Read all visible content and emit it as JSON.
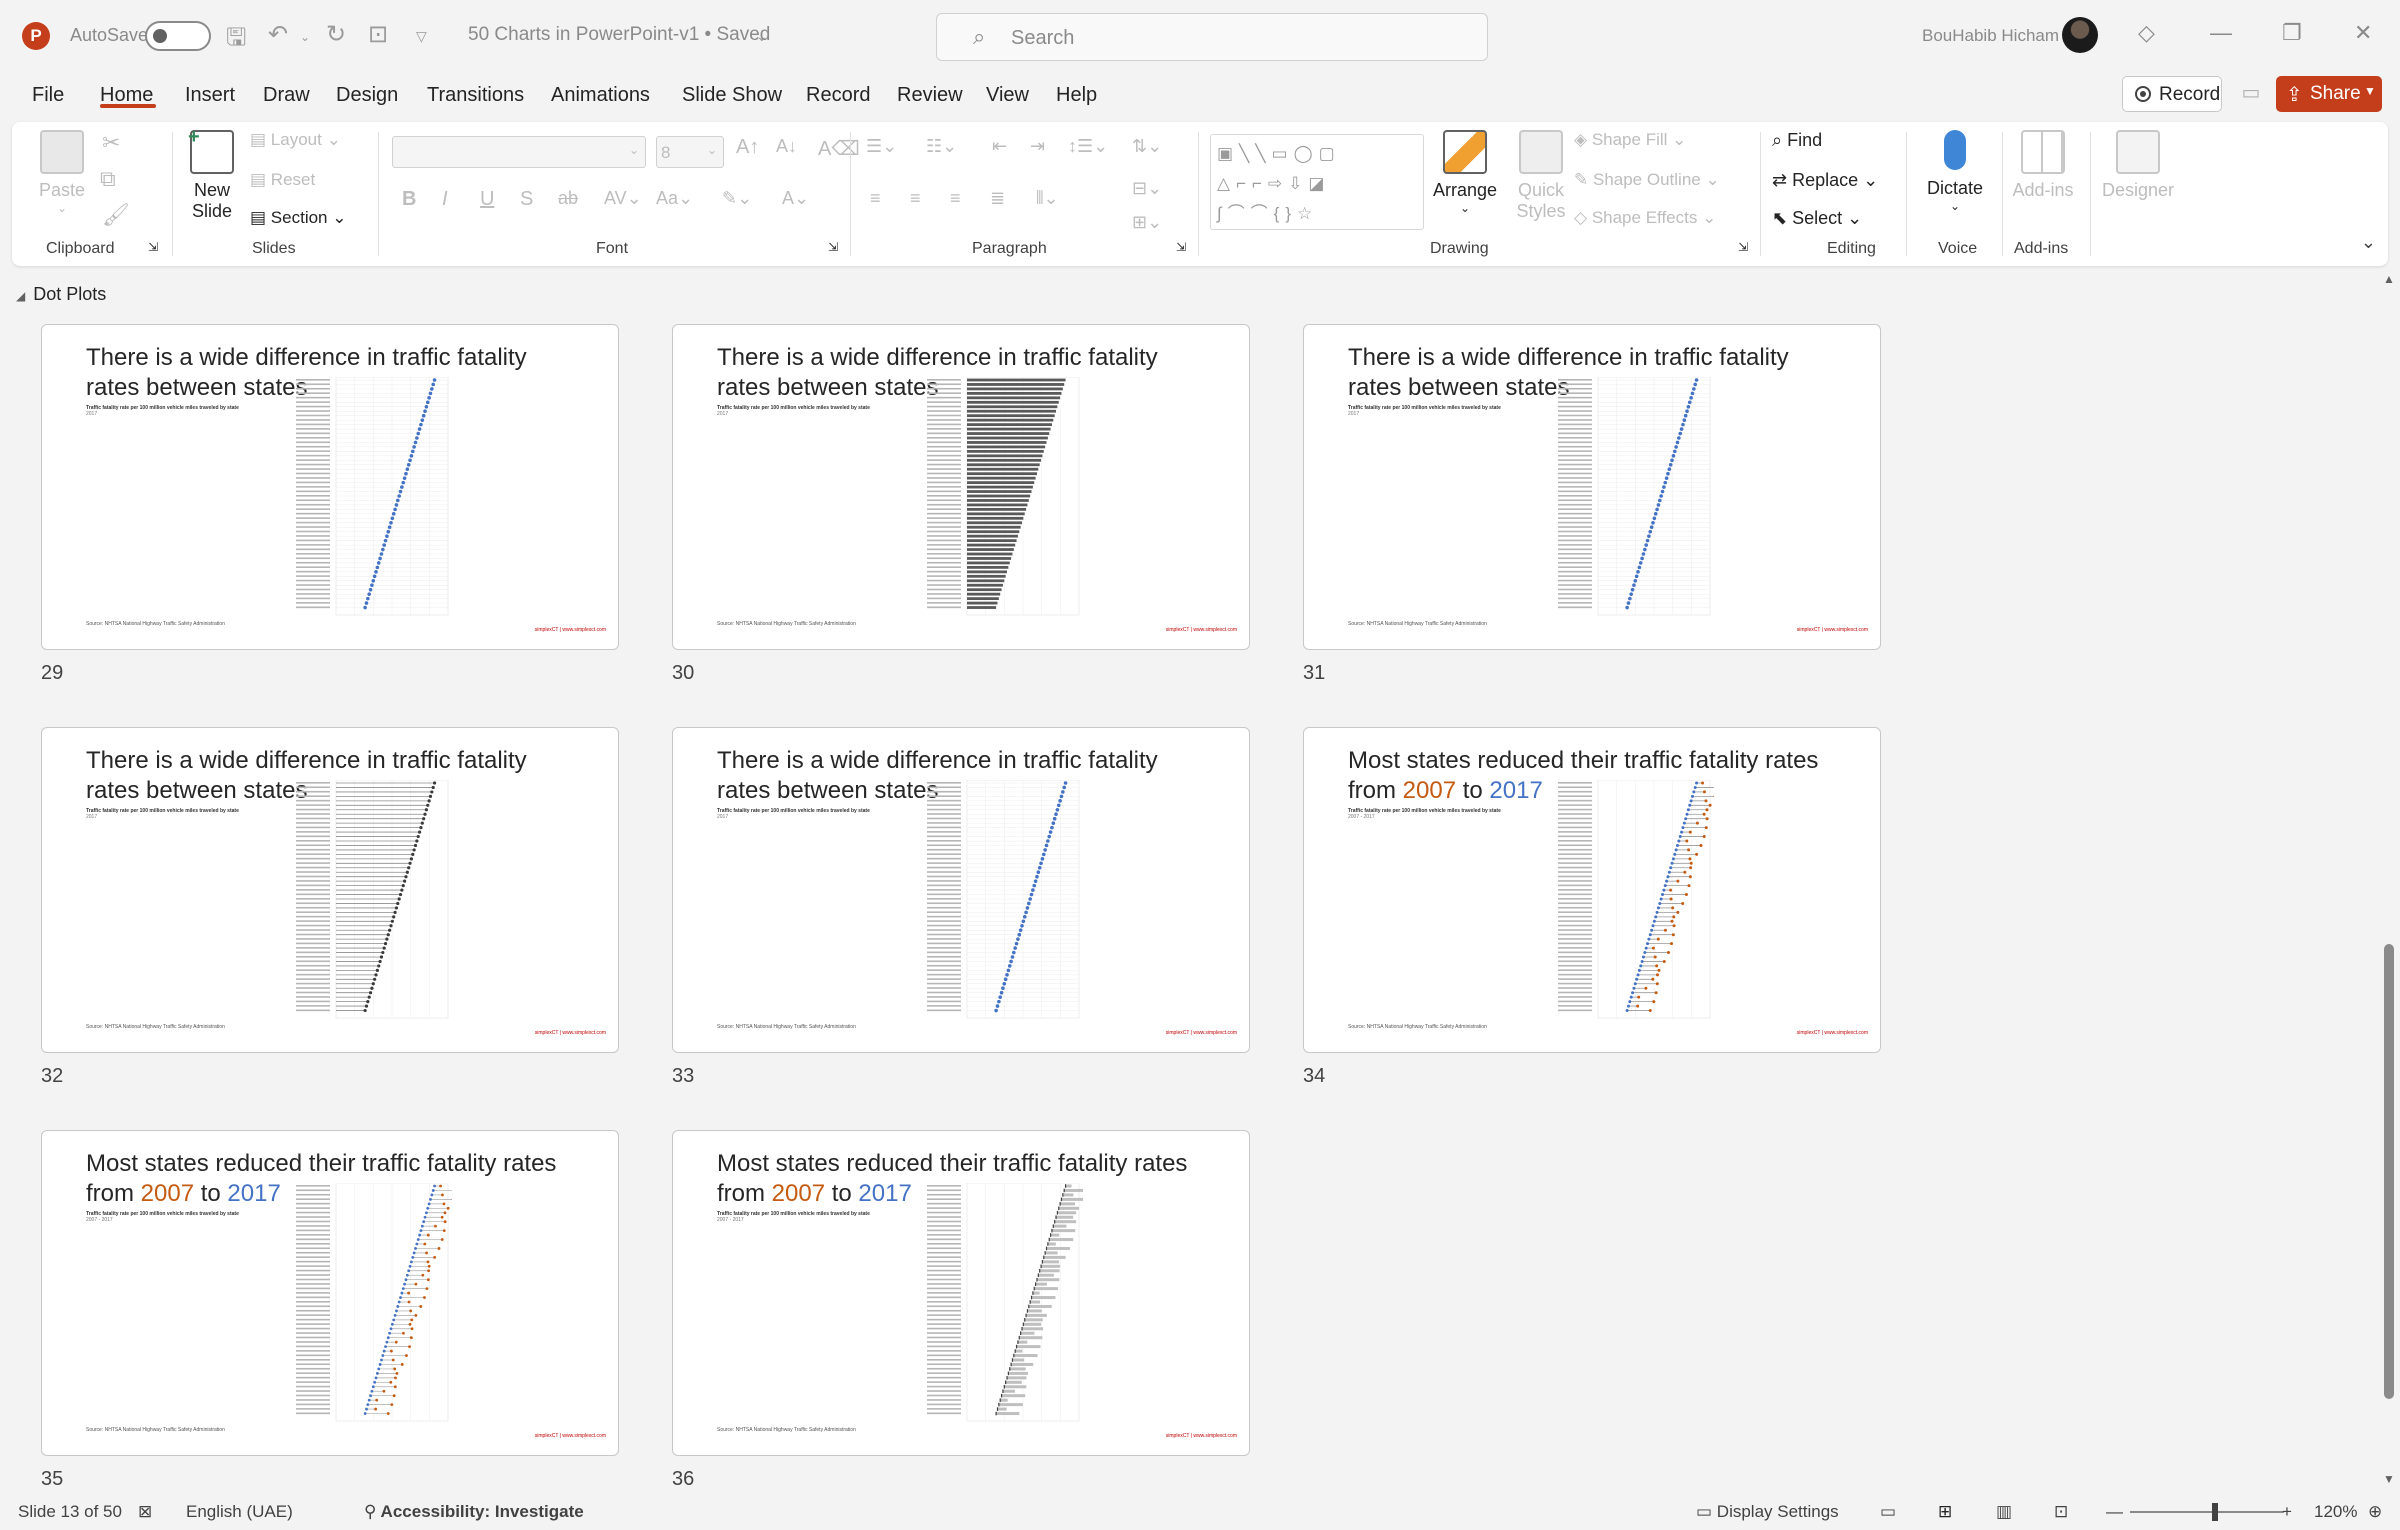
{
  "app": {
    "autosave_label": "AutoSave",
    "doc_title": "50 Charts in PowerPoint-v1 • Saved",
    "search_placeholder": "Search",
    "user_name": "BouHabib Hicham"
  },
  "menu": {
    "items": [
      "File",
      "Home",
      "Insert",
      "Draw",
      "Design",
      "Transitions",
      "Animations",
      "Slide Show",
      "Record",
      "Review",
      "View",
      "Help"
    ],
    "active": "Home",
    "record_label": "Record",
    "share_label": "Share"
  },
  "ribbon": {
    "clipboard": {
      "paste": "Paste",
      "group": "Clipboard"
    },
    "slides": {
      "new_slide": "New Slide",
      "layout": "Layout",
      "reset": "Reset",
      "section": "Section",
      "group": "Slides"
    },
    "font": {
      "size": "8",
      "group": "Font"
    },
    "paragraph": {
      "group": "Paragraph"
    },
    "drawing": {
      "arrange": "Arrange",
      "quick_styles": "Quick Styles",
      "shape_fill": "Shape Fill",
      "shape_outline": "Shape Outline",
      "shape_effects": "Shape Effects",
      "group": "Drawing"
    },
    "editing": {
      "find": "Find",
      "replace": "Replace",
      "select": "Select",
      "group": "Editing"
    },
    "voice": {
      "dictate": "Dictate",
      "group": "Voice"
    },
    "addins": {
      "addins": "Add-ins",
      "group": "Add-ins"
    },
    "designer": {
      "label": "Designer"
    }
  },
  "section": {
    "name": "Dot Plots"
  },
  "slides": [
    {
      "num": "29",
      "title": "There is a wide difference in traffic fatality rates between states",
      "subtitle": "Traffic fatality rate per 100 million vehicle miles traveled by state",
      "year": "2017",
      "style": "dots"
    },
    {
      "num": "30",
      "title": "There is a wide difference in traffic fatality rates between states",
      "subtitle": "Traffic fatality rate per 100 million vehicle miles traveled by state",
      "year": "2017",
      "style": "bars"
    },
    {
      "num": "31",
      "title": "There is a wide difference in traffic fatality rates between states",
      "subtitle": "Traffic fatality rate per 100 million vehicle miles traveled by state",
      "year": "2017",
      "style": "dots"
    },
    {
      "num": "32",
      "title": "There is a wide difference in traffic fatality rates between states",
      "subtitle": "Traffic fatality rate per 100 million vehicle miles traveled by state",
      "year": "2017",
      "style": "lollipop"
    },
    {
      "num": "33",
      "title": "There is a wide difference in traffic fatality rates between states",
      "subtitle": "Traffic fatality rate per 100 million vehicle miles traveled by state",
      "year": "2017",
      "style": "dots"
    },
    {
      "num": "34",
      "title_a": "Most states reduced their traffic fatality rates from ",
      "y1": "2007",
      "mid": " to ",
      "y2": "2017",
      "subtitle": "Traffic fatality rate per 100 million vehicle miles traveled by state",
      "year": "2007 - 2017",
      "style": "dumbbell"
    },
    {
      "num": "35",
      "title_a": "Most states reduced their traffic fatality rates from ",
      "y1": "2007",
      "mid": " to ",
      "y2": "2017",
      "subtitle": "Traffic fatality rate per 100 million vehicle miles traveled by state",
      "year": "2007 - 2017",
      "style": "arrows"
    },
    {
      "num": "36",
      "title_a": "Most states reduced their traffic fatality rates from ",
      "y1": "2007",
      "mid": " to ",
      "y2": "2017",
      "subtitle": "Traffic fatality rate per 100 million vehicle miles traveled by state",
      "year": "2007 - 2017",
      "style": "rangebars"
    }
  ],
  "slide_footer": {
    "source": "Source: NHTSA National Highway Traffic Safety Administration",
    "brand": "simplexCT | www.simplexct.com"
  },
  "status": {
    "slide_count": "Slide 13 of 50",
    "language": "English (UAE)",
    "accessibility": "Accessibility: Investigate",
    "display_settings": "Display Settings",
    "zoom": "120%"
  },
  "colors": {
    "accent": "#c43e1c",
    "year1": "#c55a11",
    "year2": "#4472c4"
  }
}
